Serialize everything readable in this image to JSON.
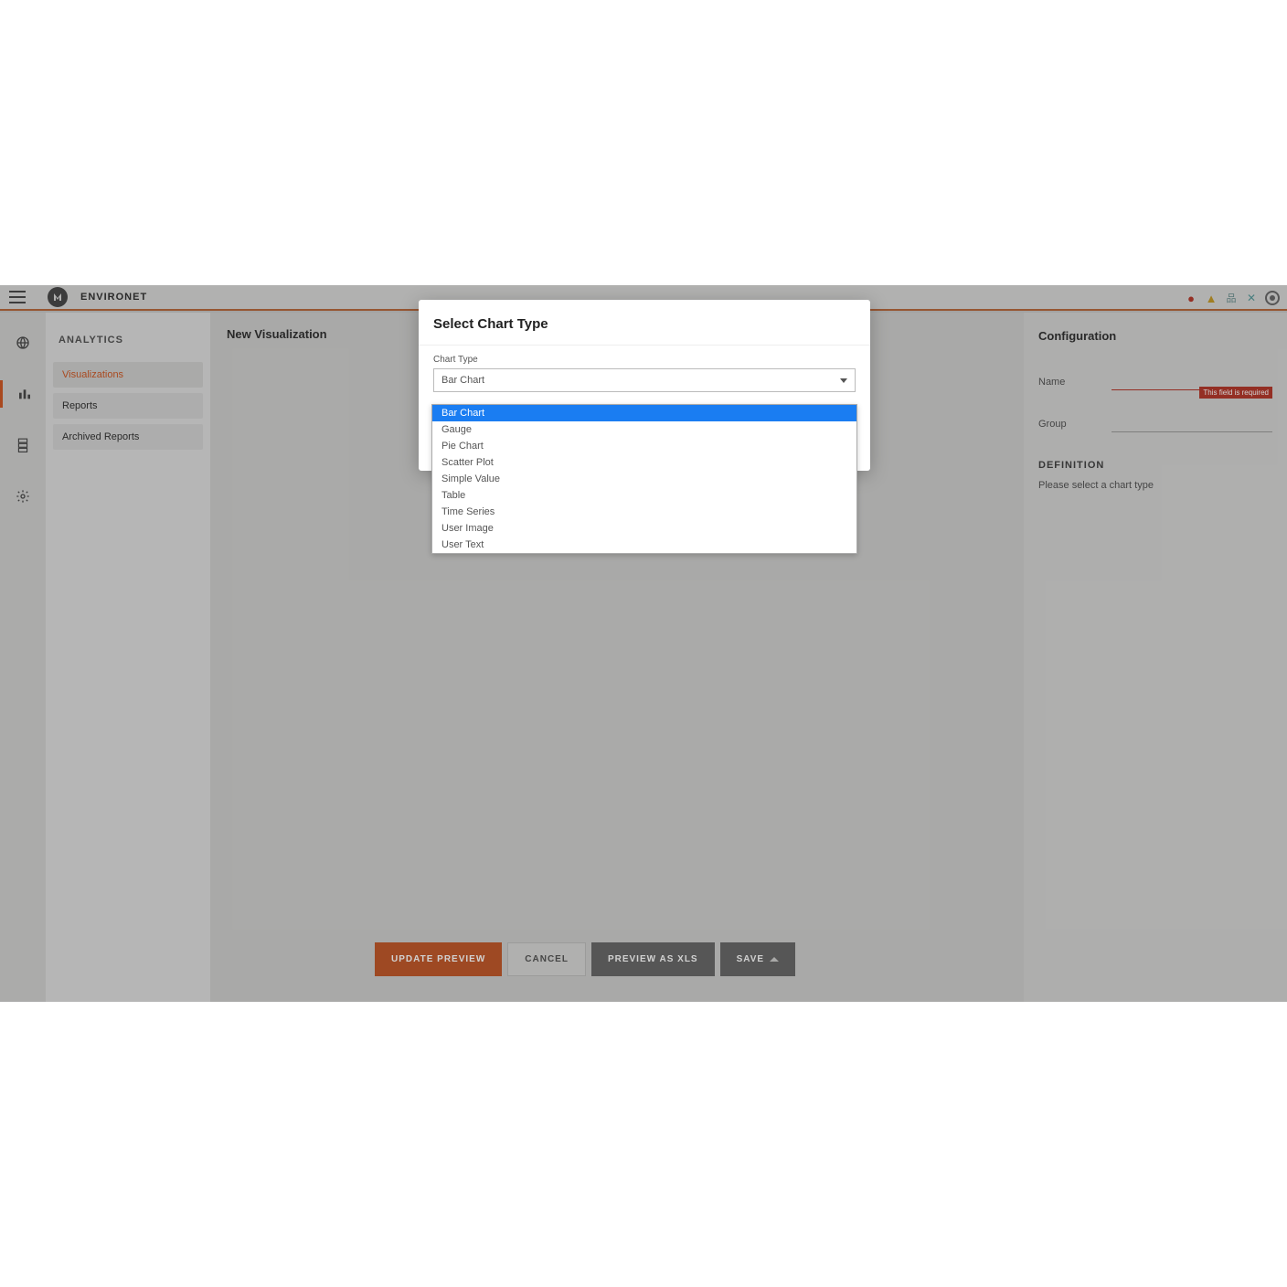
{
  "brand": "ENVIRONET",
  "topbar_icons": {
    "alert": "alert-circle-icon",
    "warning": "warning-triangle-icon",
    "network": "network-icon",
    "tools": "tools-icon",
    "user": "user-icon"
  },
  "rail": {
    "items": [
      "globe-icon",
      "bar-chart-icon",
      "server-icon",
      "gear-icon"
    ],
    "active_index": 1
  },
  "sidebar": {
    "title": "ANALYTICS",
    "items": [
      "Visualizations",
      "Reports",
      "Archived Reports"
    ],
    "active_index": 0
  },
  "main": {
    "title": "New Visualization"
  },
  "buttons": {
    "update": "UPDATE PREVIEW",
    "cancel": "CANCEL",
    "preview_xls": "PREVIEW AS XLS",
    "save": "SAVE"
  },
  "config": {
    "title": "Configuration",
    "name_label": "Name",
    "group_label": "Group",
    "name_error": "This field is required",
    "definition_heading": "DEFINITION",
    "definition_text": "Please select a chart type"
  },
  "modal": {
    "title": "Select Chart Type",
    "field_label": "Chart Type",
    "selected": "Bar Chart",
    "options": [
      "Bar Chart",
      "Gauge",
      "Pie Chart",
      "Scatter Plot",
      "Simple Value",
      "Table",
      "Time Series",
      "User Image",
      "User Text"
    ],
    "highlighted_index": 0
  }
}
